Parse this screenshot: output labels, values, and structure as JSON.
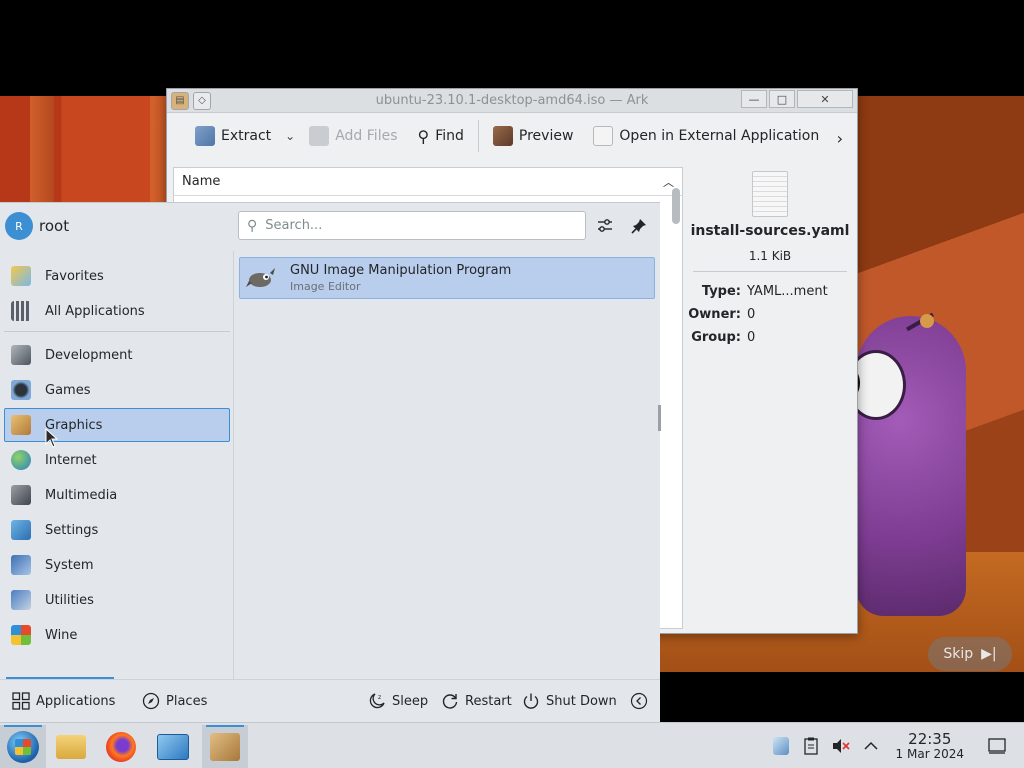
{
  "ark": {
    "title": "ubuntu-23.10.1-desktop-amd64.iso — Ark",
    "toolbar": {
      "extract": "Extract",
      "add_files": "Add Files",
      "find": "Find",
      "preview": "Preview",
      "open_external": "Open in External Application"
    },
    "column_name": "Name",
    "info": {
      "file_name": "install-sources.yaml",
      "file_size": "1.1 KiB",
      "type_label": "Type:",
      "type_value": "YAML...ment",
      "owner_label": "Owner:",
      "owner_value": "0",
      "group_label": "Group:",
      "group_value": "0"
    }
  },
  "launcher": {
    "avatar_initial": "R",
    "username": "root",
    "search_placeholder": "Search...",
    "categories": [
      {
        "label": "Favorites",
        "icon": "favorites-icon"
      },
      {
        "label": "All Applications",
        "icon": "all-applications-icon"
      },
      {
        "label": "Development",
        "icon": "development-icon"
      },
      {
        "label": "Games",
        "icon": "games-icon"
      },
      {
        "label": "Graphics",
        "icon": "graphics-icon",
        "selected": true
      },
      {
        "label": "Internet",
        "icon": "internet-icon"
      },
      {
        "label": "Multimedia",
        "icon": "multimedia-icon"
      },
      {
        "label": "Settings",
        "icon": "settings-icon"
      },
      {
        "label": "System",
        "icon": "system-icon"
      },
      {
        "label": "Utilities",
        "icon": "utilities-icon"
      },
      {
        "label": "Wine",
        "icon": "wine-icon"
      }
    ],
    "apps": [
      {
        "name": "GNU Image Manipulation Program",
        "description": "Image Editor",
        "icon": "gimp-icon"
      }
    ],
    "footer": {
      "applications": "Applications",
      "places": "Places",
      "sleep": "Sleep",
      "restart": "Restart",
      "shutdown": "Shut Down"
    }
  },
  "video": {
    "skip_label": "Skip"
  },
  "taskbar": {
    "clock_time": "22:35",
    "clock_date": "1 Mar 2024"
  },
  "colors": {
    "accent": "#3d8fd4",
    "selection": "#b9cdec"
  }
}
